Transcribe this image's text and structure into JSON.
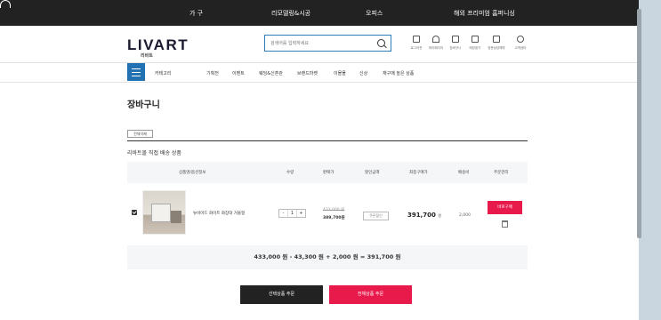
{
  "topbar": {
    "items": [
      "가 구",
      "리모델링&시공",
      "오피스",
      "해외 프리미엄 홈퍼니싱"
    ]
  },
  "header": {
    "logo": "LIVART",
    "logo_sub": "리바트",
    "search_placeholder": "검색어를 입력하세요",
    "utilities": [
      "로그아웃",
      "마이페이지",
      "장바구니",
      "매장찾기",
      "방문상담예약",
      "고객센터"
    ]
  },
  "nav": {
    "category_label": "카테고리",
    "items": [
      "기획전",
      "이벤트",
      "웨딩&신혼관",
      "브랜드마켓",
      "이몰몰",
      "신상",
      "재구매 높은 상품"
    ]
  },
  "cart": {
    "title": "장바구니",
    "delete_all_label": "전체삭제",
    "section_title": "리바트몰 직접 배송 상품",
    "columns": [
      "상품명/옵션정보",
      "수량",
      "판매가",
      "할인금액",
      "최종구매가",
      "배송비",
      "주문관리"
    ],
    "items": [
      {
        "name": "뉴비아드 화이트 화장대 거울형",
        "quantity": "1",
        "original_price": "433,000 원",
        "sale_price": "389,700원",
        "discount_label": "쿠폰할인",
        "final_price": "391,700",
        "final_unit": "원",
        "shipping": "2,000",
        "buy_label": "바로구매"
      }
    ],
    "summary": "433,000 원  -  43,300 원  +  2,000 원  =  391,700 원",
    "order_selected_label": "선택상품 주문",
    "order_all_label": "전체상품 주문"
  },
  "colors": {
    "accent": "#e8194b",
    "nav_blue": "#2271b3",
    "topbar": "#222222"
  }
}
